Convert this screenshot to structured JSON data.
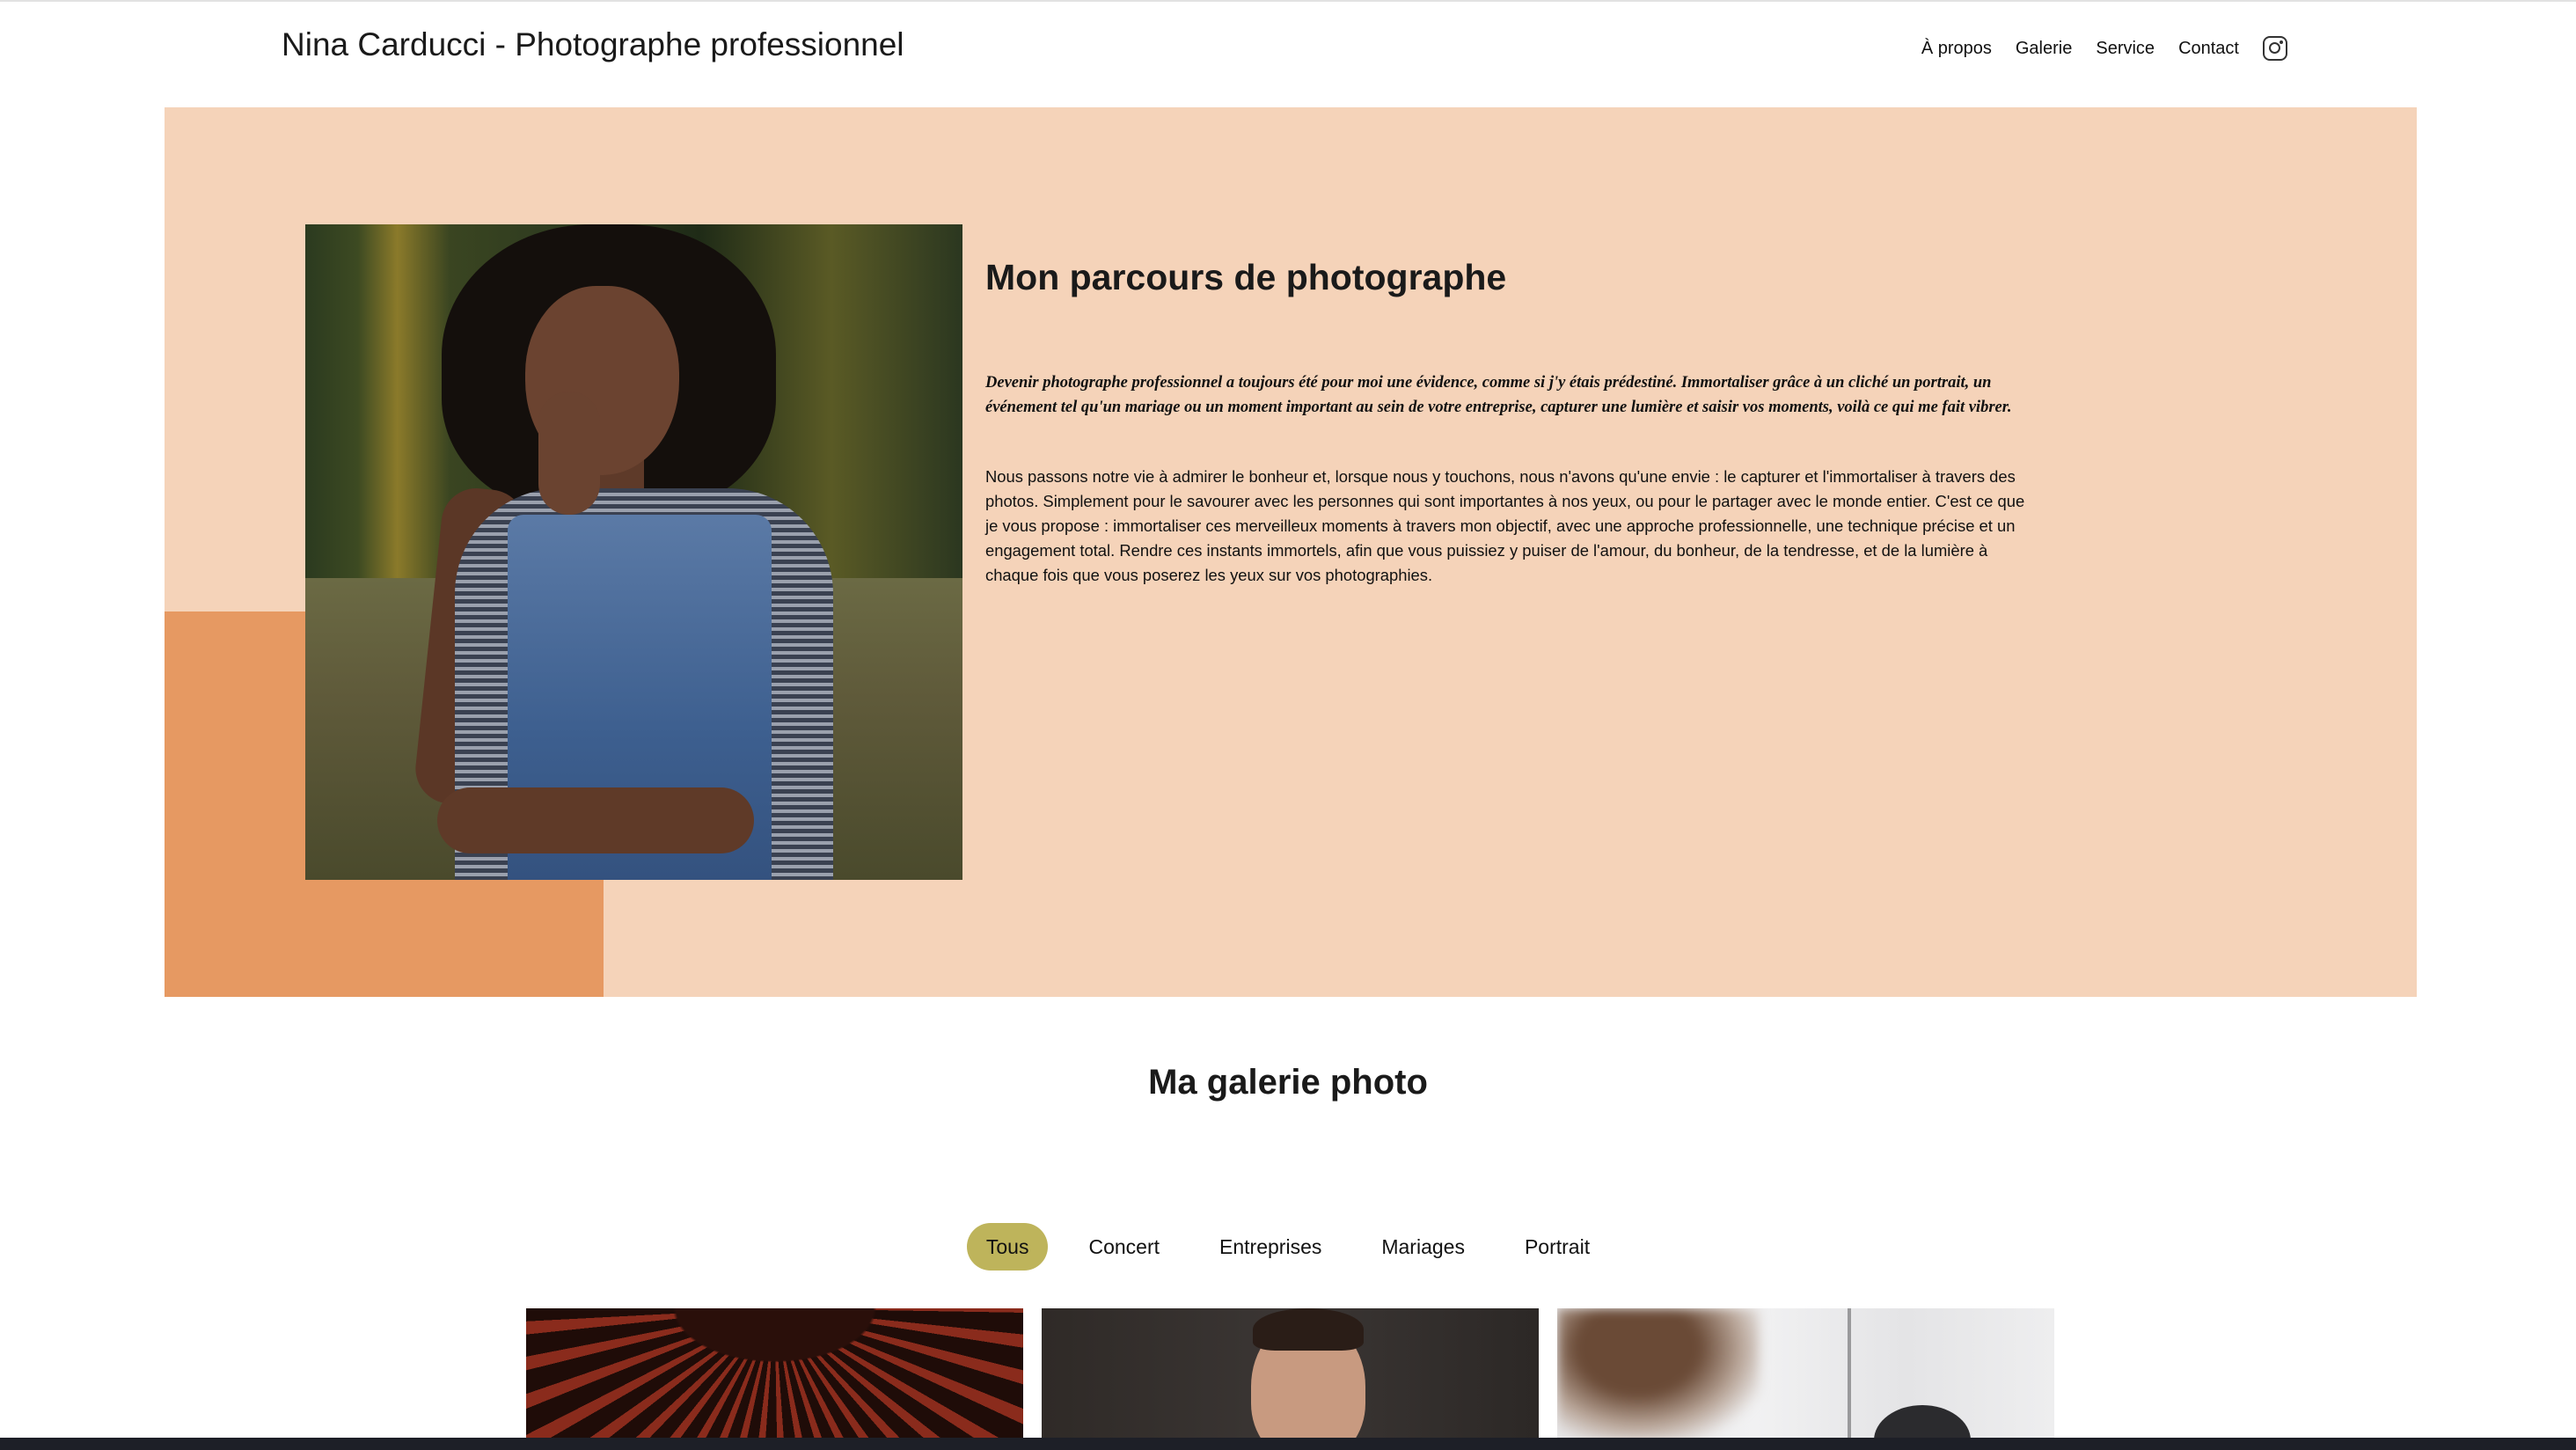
{
  "header": {
    "site_title": "Nina Carducci - Photographe professionnel",
    "nav": [
      "À propos",
      "Galerie",
      "Service",
      "Contact"
    ],
    "instagram_icon": "instagram-icon"
  },
  "about": {
    "title": "Mon parcours de photographe",
    "lead": "Devenir photographe professionnel a toujours été pour moi une évidence, comme si j'y étais prédestiné. Immortaliser grâce à un cliché un portrait, un événement tel qu'un mariage ou un moment important au sein de votre entreprise, capturer une lumière et saisir vos moments, voilà ce qui me fait vibrer.",
    "body": "Nous passons notre vie à admirer le bonheur et, lorsque nous y touchons, nous n'avons qu'une envie : le capturer et l'immortaliser à travers des photos. Simplement pour le savourer avec les personnes qui sont importantes à nos yeux, ou pour le partager avec le monde entier. C'est ce que je vous propose : immortaliser ces merveilleux moments à travers mon objectif, avec une approche professionnelle, une technique précise et un engagement total. Rendre ces instants immortels, afin que vous puissiez y puiser de l'amour, du bonheur, de la tendresse, et de la lumière à chaque fois que vous poserez les yeux sur vos photographies."
  },
  "gallery": {
    "title": "Ma galerie photo",
    "filters": [
      "Tous",
      "Concert",
      "Entreprises",
      "Mariages",
      "Portrait"
    ],
    "active_filter": "Tous"
  },
  "colors": {
    "about_bg": "#f5d3b9",
    "accent": "#e69962",
    "active_filter": "#beb45b"
  }
}
